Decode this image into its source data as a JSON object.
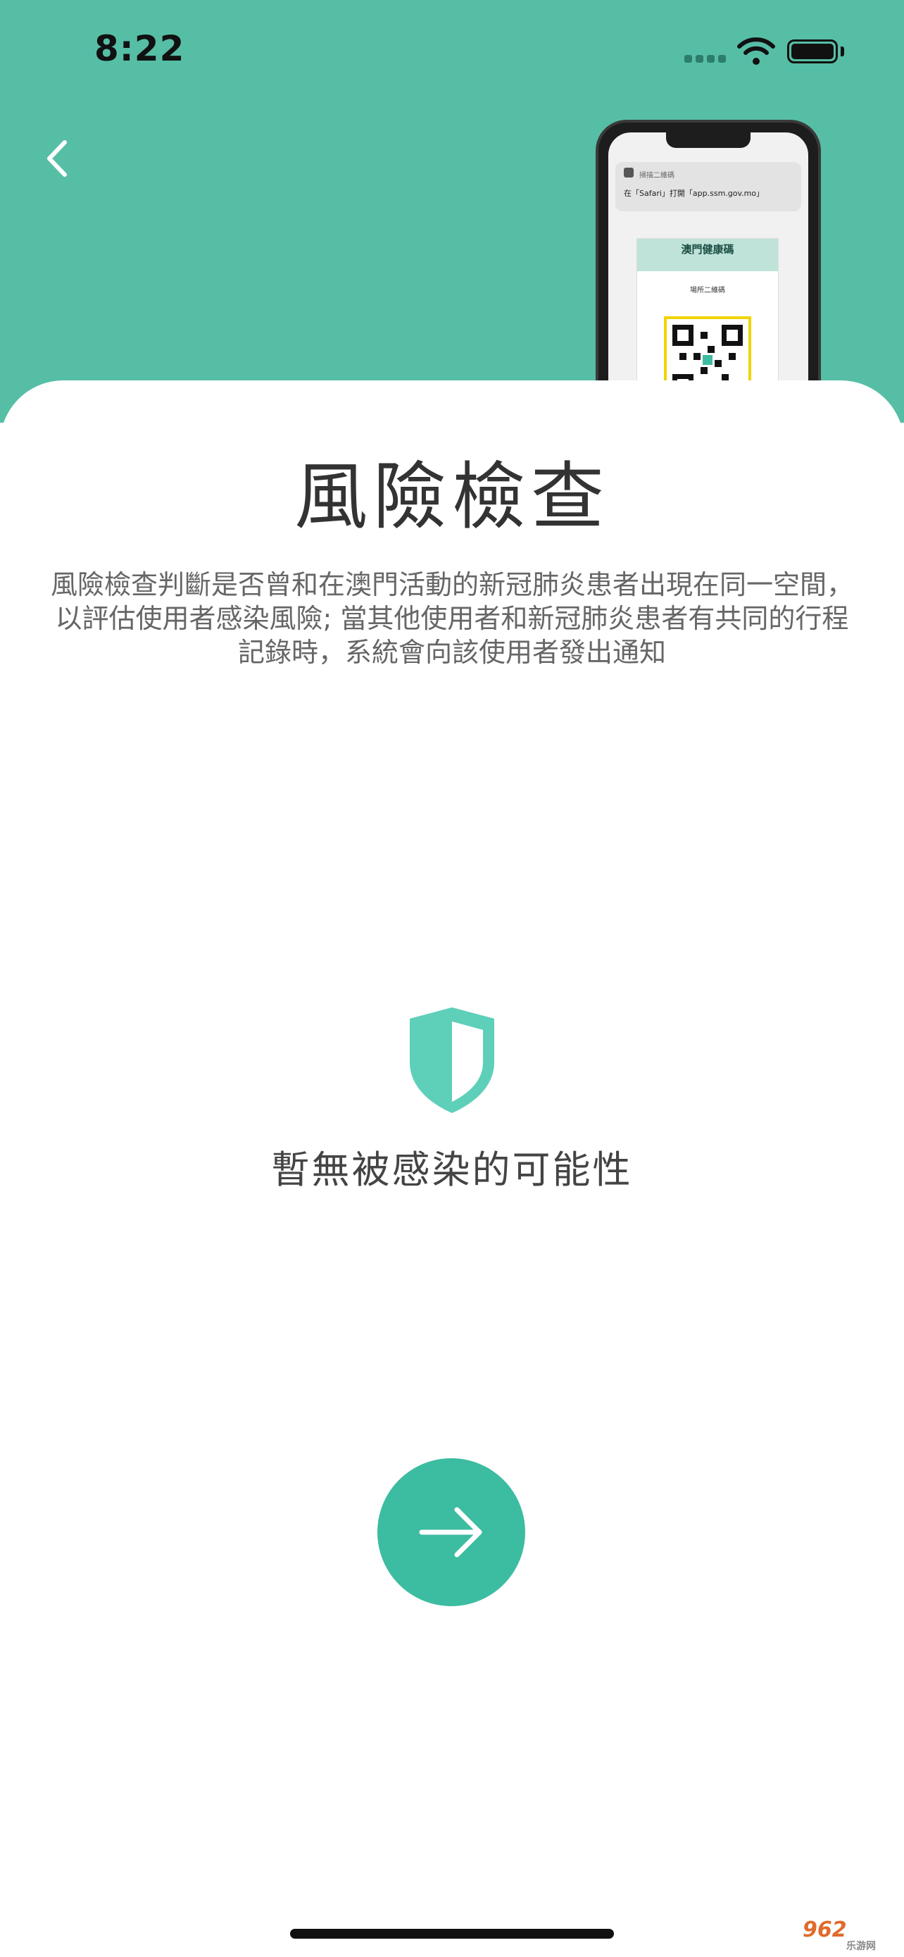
{
  "status_bar": {
    "time": "8:22"
  },
  "mockup": {
    "banner_title": "掃描二維碼",
    "banner_text": "在「Safari」打開「app.ssm.gov.mo」",
    "card_title": "澳門健康碼",
    "card_subtitle": "場所二維碼"
  },
  "page": {
    "title": "風險檢查",
    "description": "風險檢查判斷是否曾和在澳門活動的新冠肺炎患者出現在同一空間，以評估使用者感染風險; 當其他使用者和新冠肺炎患者有共同的行程記錄時，系統會向該使用者發出通知",
    "status": "暫無被感染的可能性"
  },
  "icons": {
    "back": "chevron-left-icon",
    "shield": "shield-icon",
    "next": "arrow-right-icon"
  },
  "colors": {
    "header": "#57bea6",
    "accent": "#3cbca0",
    "shield": "#5ecfb9"
  },
  "watermark": {
    "brand": "962",
    "sub": "乐游网"
  }
}
